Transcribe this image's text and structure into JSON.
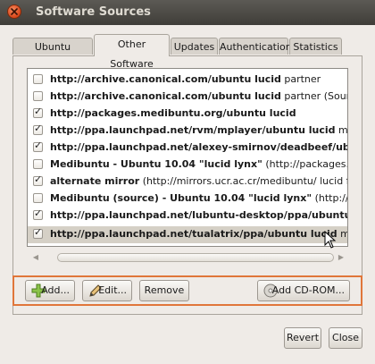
{
  "window": {
    "title": "Software Sources"
  },
  "tabs": [
    {
      "label": "Ubuntu Software",
      "active": false
    },
    {
      "label": "Other Software",
      "active": true
    },
    {
      "label": "Updates",
      "active": false
    },
    {
      "label": "Authentication",
      "active": false
    },
    {
      "label": "Statistics",
      "active": false
    }
  ],
  "sources": [
    {
      "checked": false,
      "selected": false,
      "bold": "http://archive.canonical.com/ubuntu lucid",
      "normal": " partner"
    },
    {
      "checked": false,
      "selected": false,
      "bold": "http://archive.canonical.com/ubuntu lucid",
      "normal": " partner (Source Code)"
    },
    {
      "checked": true,
      "selected": false,
      "bold": "http://packages.medibuntu.org/ubuntu lucid",
      "normal": ""
    },
    {
      "checked": true,
      "selected": false,
      "bold": "http://ppa.launchpad.net/rvm/mplayer/ubuntu lucid",
      "normal": " main"
    },
    {
      "checked": true,
      "selected": false,
      "bold": "http://ppa.launchpad.net/alexey-smirnov/deadbeef/ubuntu lucid",
      "normal": ""
    },
    {
      "checked": false,
      "selected": false,
      "bold": "Medibuntu - Ubuntu 10.04 \"lucid lynx\"",
      "normal": " (http://packages.medibuntu"
    },
    {
      "checked": true,
      "selected": false,
      "bold": "alternate mirror",
      "normal": " (http://mirrors.ucr.ac.cr/medibuntu/ lucid free non-free"
    },
    {
      "checked": false,
      "selected": false,
      "bold": "Medibuntu (source) - Ubuntu 10.04 \"lucid lynx\"",
      "normal": " (http://packages.m"
    },
    {
      "checked": true,
      "selected": false,
      "bold": "http://ppa.launchpad.net/lubuntu-desktop/ppa/ubuntu lucid",
      "normal": ""
    },
    {
      "checked": true,
      "selected": true,
      "bold": "http://ppa.launchpad.net/tualatrix/ppa/ubuntu lucid",
      "normal": " main"
    }
  ],
  "actions": {
    "add": "Add...",
    "edit": "Edit...",
    "remove": "Remove",
    "add_cdrom": "Add CD-ROM..."
  },
  "footer": {
    "revert": "Revert",
    "close": "Close"
  },
  "icons": {
    "close": "close-icon",
    "add": "plus-icon",
    "edit": "pencil-icon",
    "cdrom": "cdrom-icon"
  },
  "colors": {
    "highlight_frame": "#e0763a",
    "selected_row": "#d5d0c6"
  }
}
